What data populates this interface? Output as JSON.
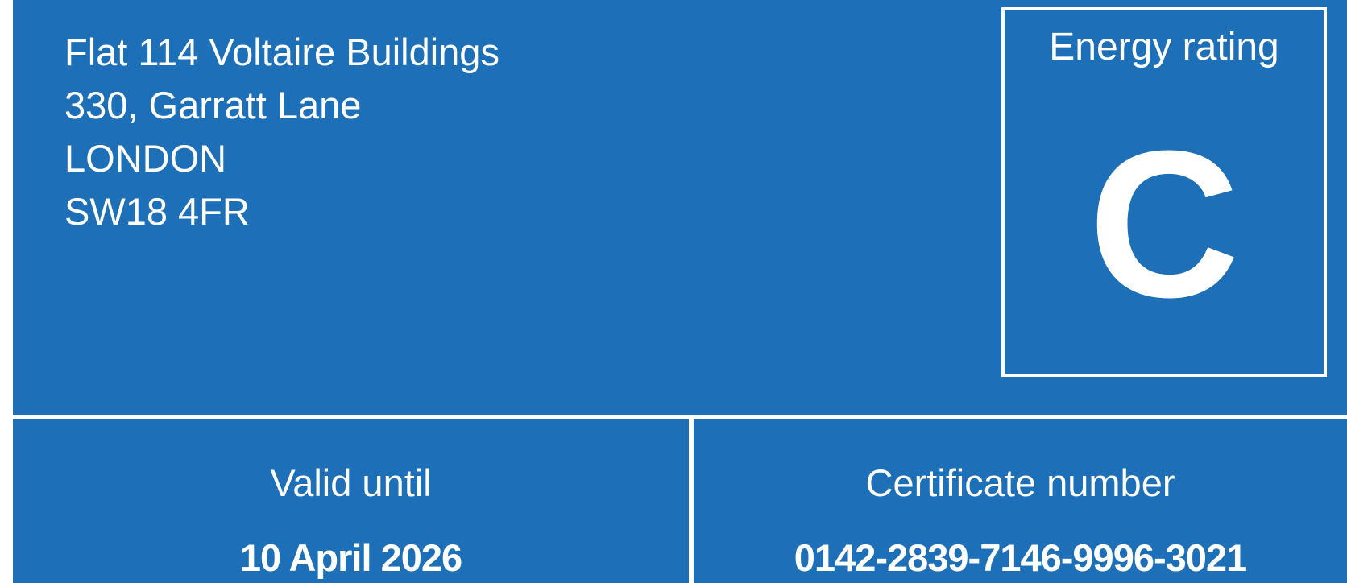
{
  "address": {
    "lines": [
      "Flat 114 Voltaire Buildings",
      "330, Garratt Lane",
      "LONDON",
      "SW18 4FR"
    ]
  },
  "energy_rating": {
    "label": "Energy rating",
    "value": "C"
  },
  "valid_until": {
    "label": "Valid until",
    "value": "10 April 2026"
  },
  "certificate_number": {
    "label": "Certificate number",
    "value": "0142-2839-7146-9996-3021"
  },
  "colors": {
    "panel_blue": "#1d70b8",
    "text_white": "#ffffff"
  }
}
